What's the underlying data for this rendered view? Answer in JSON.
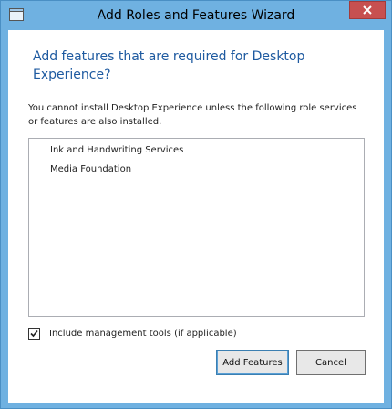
{
  "window": {
    "title": "Add Roles and Features Wizard"
  },
  "dialog": {
    "heading": "Add features that are required for Desktop Experience?",
    "description": "You cannot install Desktop Experience unless the following role services or features are also installed.",
    "required_features": [
      "Ink and Handwriting Services",
      "Media Foundation"
    ],
    "include_tools": {
      "label": "Include management tools (if applicable)",
      "checked": true
    },
    "buttons": {
      "add_features": "Add Features",
      "cancel": "Cancel"
    }
  },
  "colors": {
    "titlebar": "#6fb1e1",
    "heading": "#1e5aa0",
    "close_button": "#c75050"
  }
}
